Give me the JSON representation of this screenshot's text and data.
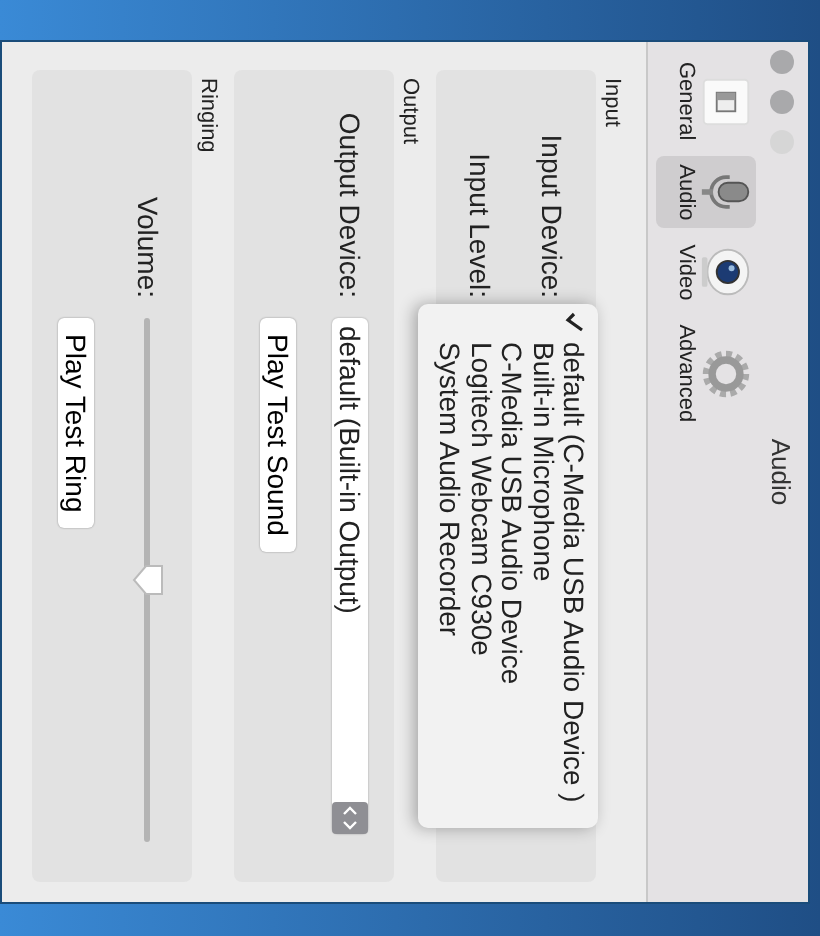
{
  "window": {
    "title": "Audio"
  },
  "toolbar": [
    {
      "label": "General",
      "kind": "general",
      "selected": false
    },
    {
      "label": "Audio",
      "kind": "audio",
      "selected": true
    },
    {
      "label": "Video",
      "kind": "video",
      "selected": false
    },
    {
      "label": "Advanced",
      "kind": "advanced",
      "selected": false
    }
  ],
  "input": {
    "label": "Input",
    "device_label": "Input Device:",
    "level_label": "Input Level:",
    "menu": [
      {
        "label": "default (C-Media USB Audio Device  )",
        "checked": true
      },
      {
        "label": "Built-in Microphone",
        "checked": false
      },
      {
        "label": "C-Media USB Audio Device",
        "checked": false
      },
      {
        "label": "Logitech Webcam C930e",
        "checked": false
      },
      {
        "label": "System Audio Recorder",
        "checked": false
      }
    ]
  },
  "output": {
    "label": "Output",
    "device_label": "Output Device:",
    "device_value": "default (Built-in Output)",
    "button": "Play Test Sound"
  },
  "ringing": {
    "label": "Ringing",
    "volume_label": "Volume:",
    "level": 0.5,
    "button": "Play Test Ring"
  }
}
